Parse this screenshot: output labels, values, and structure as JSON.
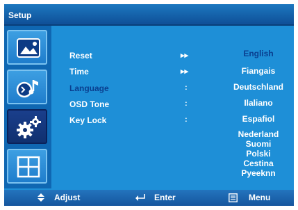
{
  "window": {
    "title": "Setup"
  },
  "sidebar": {
    "tabs": [
      {
        "icon": "picture-icon",
        "active": false
      },
      {
        "icon": "sound-icon",
        "active": false
      },
      {
        "icon": "gears-icon",
        "active": true
      },
      {
        "icon": "grid-icon",
        "active": false
      }
    ]
  },
  "menu": {
    "items": [
      {
        "label": "Reset",
        "separator": "▸▸"
      },
      {
        "label": "Time",
        "separator": "▸▸"
      },
      {
        "label": "Language",
        "separator": ":"
      },
      {
        "label": "OSD Tone",
        "separator": ":"
      },
      {
        "label": "Key Lock",
        "separator": ":"
      }
    ],
    "selected_item": "Language"
  },
  "languages": {
    "options": [
      "English",
      "Fiangais",
      "Deutschland",
      "Ilaliano",
      "Espafiol",
      "Nederland",
      "Suomi",
      "Polski",
      "Cestina",
      "Pyeeknn"
    ],
    "selected": "English"
  },
  "footer": {
    "adjust_label": "Adjust",
    "enter_label": "Enter",
    "menu_label": "Menu"
  },
  "colors": {
    "panel": "#1e8fd7",
    "selected_text": "#0a3f8f",
    "title_bar": "#0f4f97"
  }
}
